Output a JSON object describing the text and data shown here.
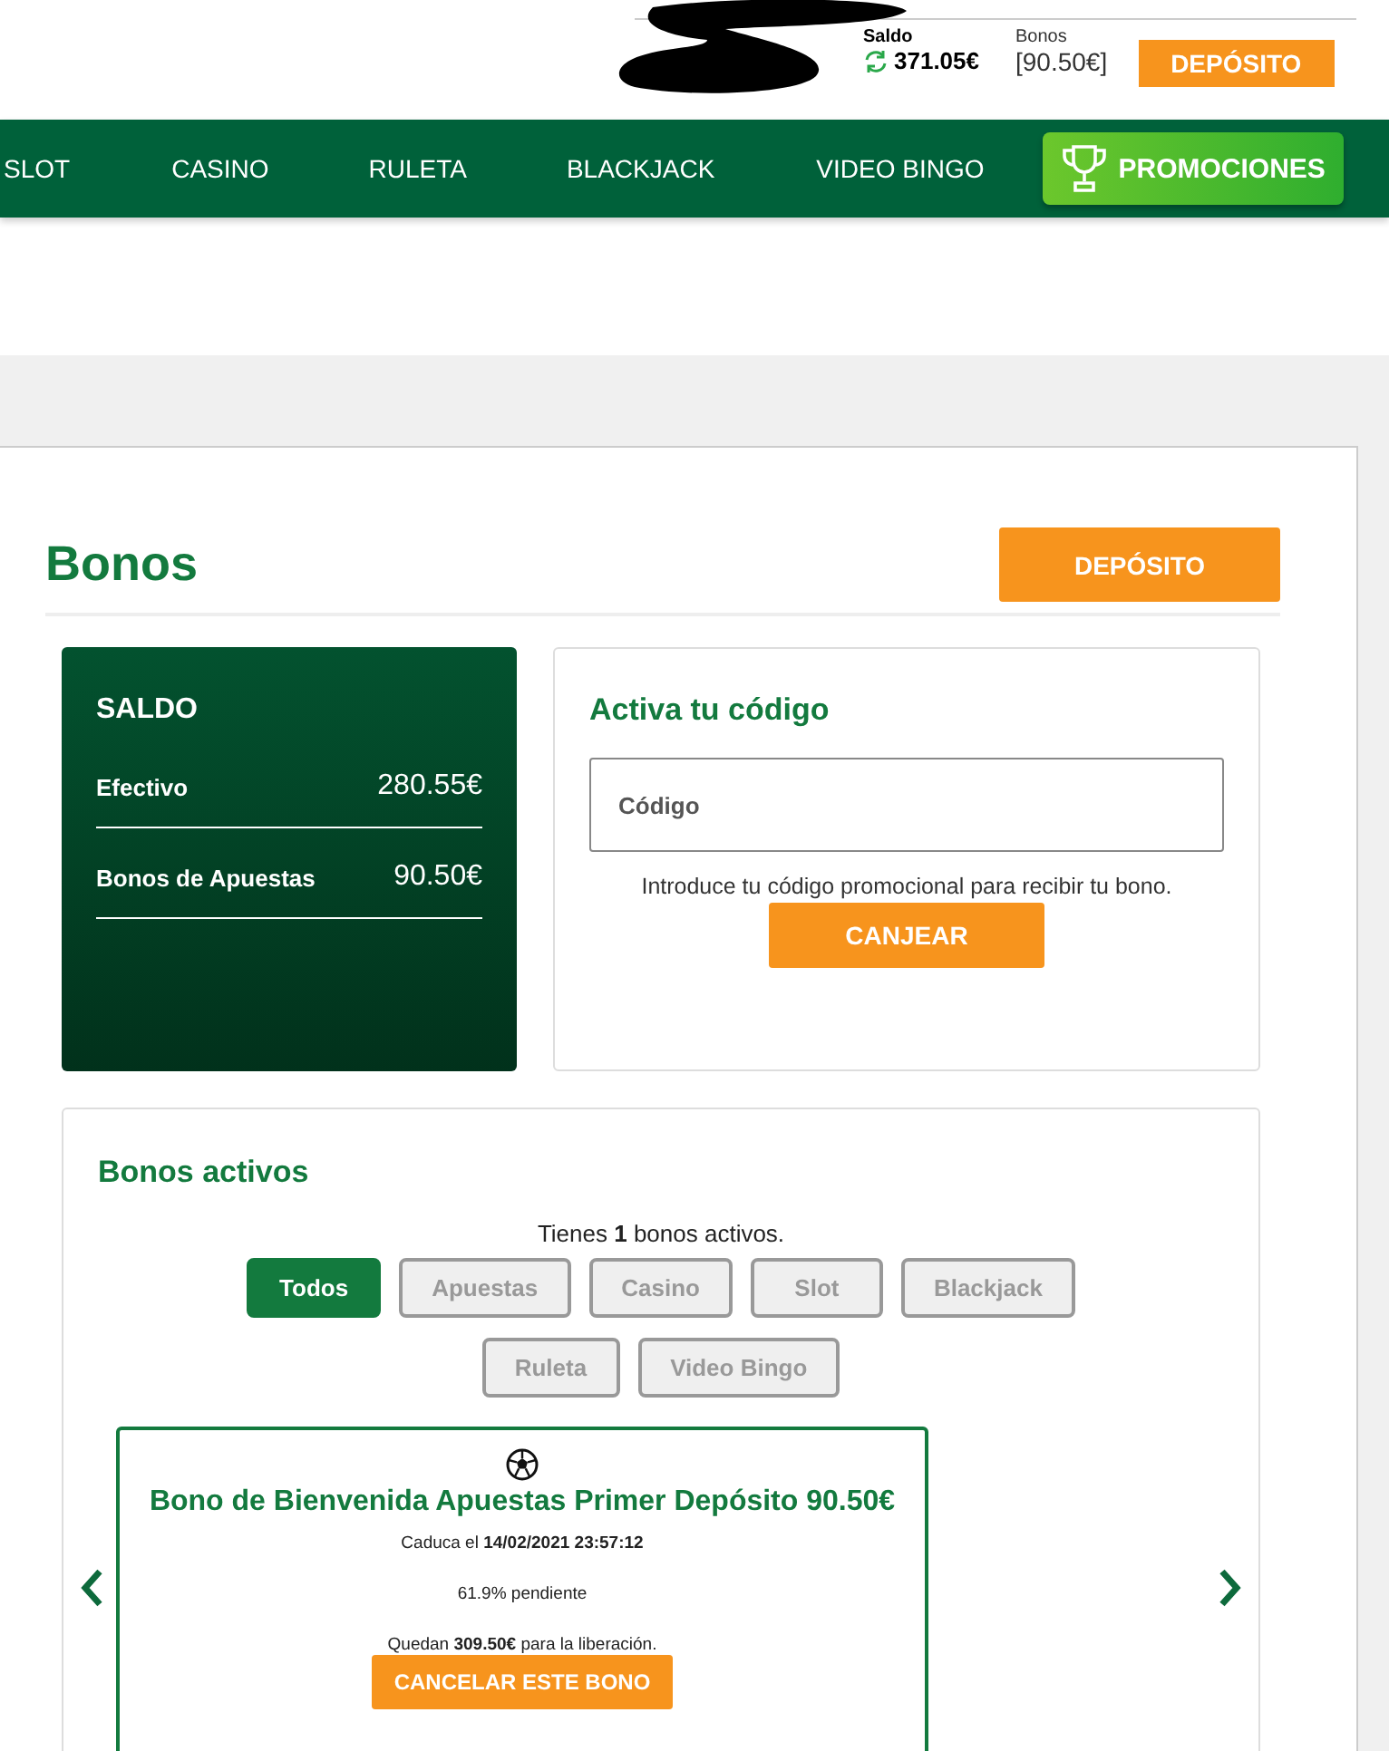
{
  "header": {
    "balance_label": "Saldo",
    "balance": "371.05€",
    "bonus_label": "Bonos",
    "bonus": "[90.50€]",
    "deposit_button": "DEPÓSITO"
  },
  "nav": {
    "items": [
      "SLOT",
      "CASINO",
      "RULETA",
      "BLACKJACK",
      "VIDEO BINGO"
    ],
    "promo_button": "PROMOCIONES"
  },
  "page": {
    "title": "Bonos",
    "deposit_button": "DEPÓSITO"
  },
  "balance_card": {
    "title": "SALDO",
    "rows": [
      {
        "label": "Efectivo",
        "value": "280.55€"
      },
      {
        "label": "Bonos de Apuestas",
        "value": "90.50€"
      }
    ]
  },
  "code_card": {
    "title": "Activa tu código",
    "placeholder": "Código",
    "hint": "Introduce tu código promocional para recibir tu bono.",
    "button": "CANJEAR"
  },
  "active_bonuses": {
    "title": "Bonos activos",
    "summary": "Tienes **1** bonos activos.",
    "filters": [
      {
        "label": "Todos",
        "selected": true
      },
      {
        "label": "Apuestas",
        "selected": false
      },
      {
        "label": "Casino",
        "selected": false
      },
      {
        "label": "Slot",
        "selected": false
      },
      {
        "label": "Blackjack",
        "selected": false
      },
      {
        "label": "Ruleta",
        "selected": false
      },
      {
        "label": "Video Bingo",
        "selected": false
      }
    ],
    "bonus": {
      "title": "Bono de Bienvenida Apuestas Primer Depósito 90.50€",
      "expiry": "Caduca el **14/02/2021 23:57:12**",
      "pending": "61.9% pendiente",
      "remaining": "Quedan **309.50€** para la liberación.",
      "cancel_button": "CANCELAR ESTE BONO"
    }
  }
}
